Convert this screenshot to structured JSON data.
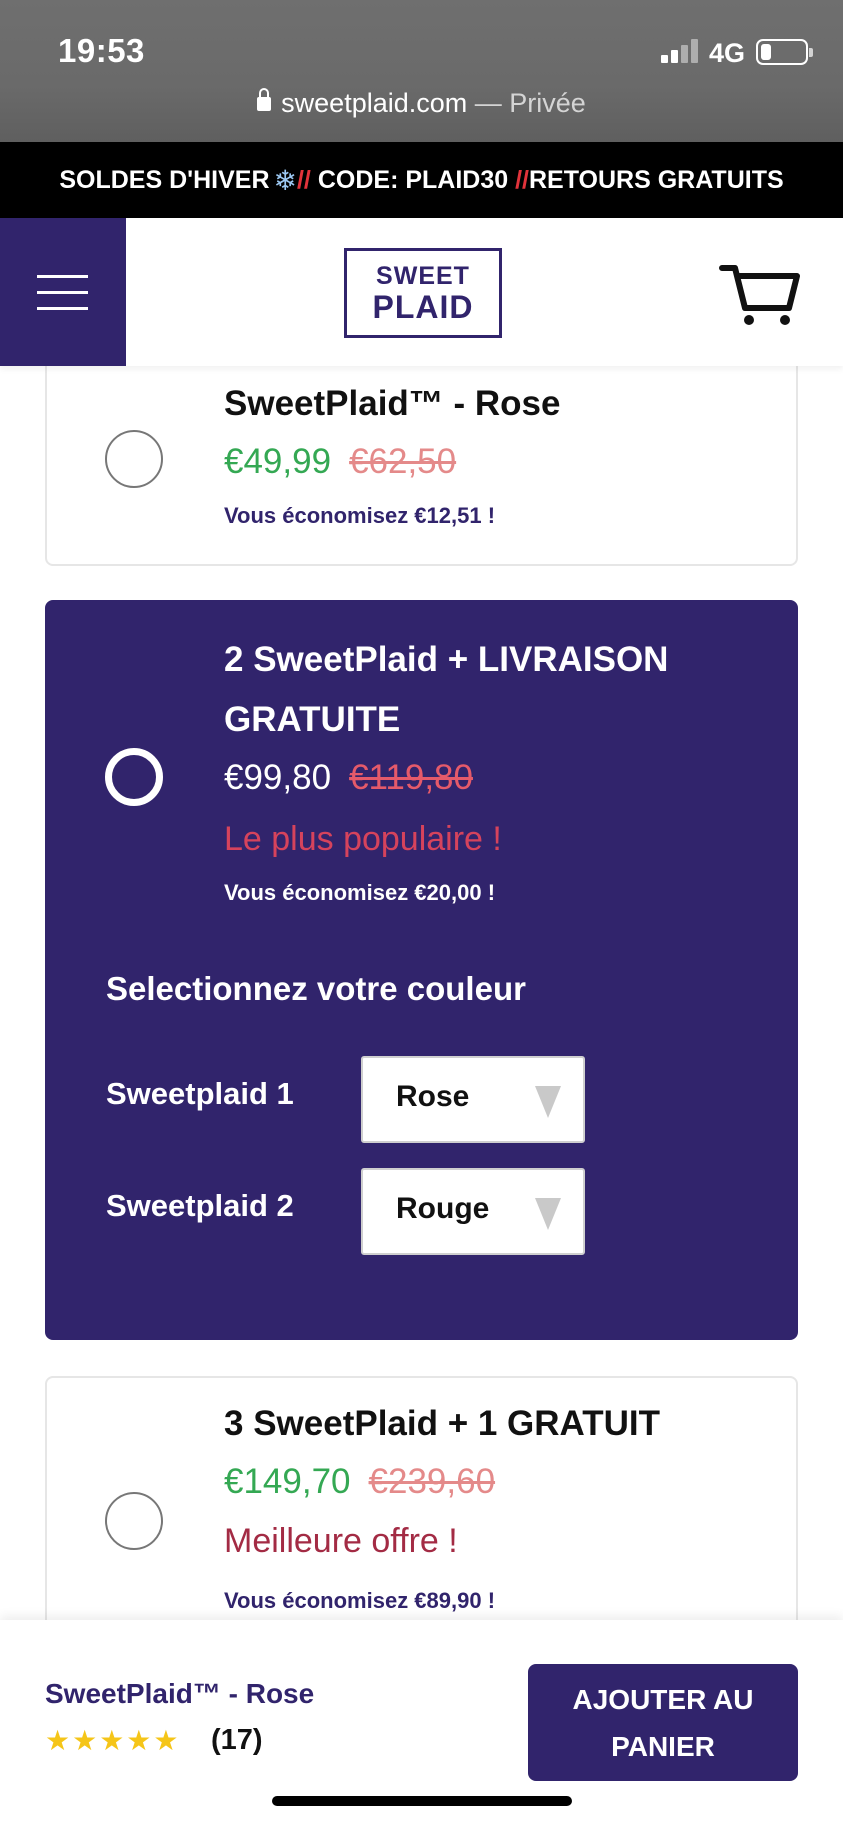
{
  "status": {
    "time": "19:53",
    "network": "4G"
  },
  "browser": {
    "domain": "sweetplaid.com",
    "mode": "— Privée"
  },
  "promo": {
    "part1": "SOLDES D'HIVER",
    "snow": "❄",
    "sep1": "//",
    "part2": " CODE: PLAID30 ",
    "sep2": "//",
    "part3": "RETOURS GRATUITS"
  },
  "header": {
    "logo_line1": "SWEET",
    "logo_line2": "PLAID"
  },
  "options": [
    {
      "title": "SweetPlaid™ - Rose",
      "price": "€49,99",
      "old_price": "€62,50",
      "tag": "",
      "saving": "Vous économisez €12,51 !"
    },
    {
      "title_line1": "2 SweetPlaid + LIVRAISON",
      "title_line2": "GRATUITE",
      "price": "€99,80",
      "old_price": "€119,80",
      "tag": "Le plus populaire !",
      "saving": "Vous économisez €20,00 !"
    },
    {
      "title": "3 SweetPlaid + 1 GRATUIT",
      "price": "€149,70",
      "old_price": "€239,60",
      "tag": "Meilleure offre !",
      "saving": "Vous économisez €89,90 !"
    }
  ],
  "color_picker": {
    "heading": "Selectionnez votre couleur",
    "items": [
      {
        "label": "Sweetplaid 1",
        "value": "Rose"
      },
      {
        "label": "Sweetplaid 2",
        "value": "Rouge"
      }
    ]
  },
  "bottom_bar": {
    "product": "SweetPlaid™ - Rose",
    "stars": "★★★★★",
    "rating": 5,
    "reviews": "(17)",
    "button": "AJOUTER AU PANIER"
  },
  "colors": {
    "brand": "#31246c",
    "sale": "#34a853",
    "tag": "#d6435c",
    "promo_sep": "#e2333b"
  }
}
